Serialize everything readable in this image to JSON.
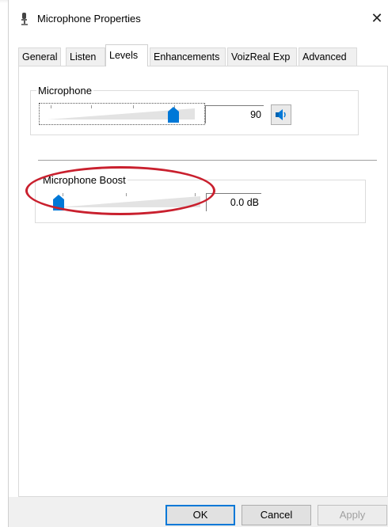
{
  "window": {
    "title": "Microphone Properties",
    "close_glyph": "✕",
    "icon": "microphone-icon"
  },
  "tabs": [
    {
      "label": "General",
      "active": false
    },
    {
      "label": "Listen",
      "active": false
    },
    {
      "label": "Levels",
      "active": true
    },
    {
      "label": "Enhancements",
      "active": false
    },
    {
      "label": "VoizReal Exp",
      "active": false
    },
    {
      "label": "Advanced",
      "active": false
    }
  ],
  "levels": {
    "microphone": {
      "label": "Microphone",
      "value": "90",
      "level_fraction": 0.9,
      "mute_icon": "speaker-icon"
    },
    "boost": {
      "label": "Microphone Boost",
      "value": "0.0 dB",
      "level_fraction": 0.0
    }
  },
  "buttons": {
    "ok": "OK",
    "cancel": "Cancel",
    "apply": "Apply"
  },
  "colors": {
    "accent": "#0078d7",
    "highlight": "#c9202e"
  }
}
